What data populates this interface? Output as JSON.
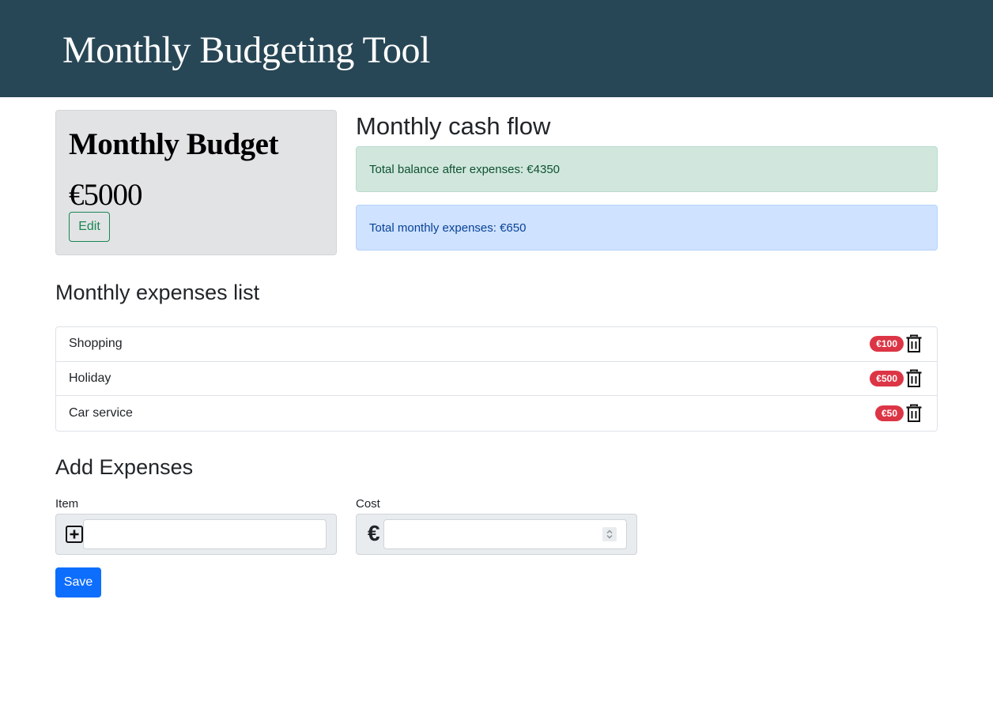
{
  "header": {
    "title": "Monthly Budgeting Tool"
  },
  "budget": {
    "title": "Monthly Budget",
    "amount": "€5000",
    "edit_label": "Edit"
  },
  "cashflow": {
    "heading": "Monthly cash flow",
    "balance_text": "Total balance after expenses: €4350",
    "expenses_text": "Total monthly expenses: €650"
  },
  "expenses": {
    "heading": "Monthly expenses list",
    "items": [
      {
        "name": "Shopping",
        "cost": "€100"
      },
      {
        "name": "Holiday",
        "cost": "€500"
      },
      {
        "name": "Car service",
        "cost": "€50"
      }
    ]
  },
  "add_form": {
    "heading": "Add Expenses",
    "item_label": "Item",
    "item_value": "",
    "cost_label": "Cost",
    "cost_symbol": "€",
    "cost_value": "",
    "save_label": "Save"
  },
  "colors": {
    "header_bg": "#284756",
    "badge": "#dc3545",
    "success_alert": "#d1e7dd",
    "primary_alert": "#cfe2ff",
    "save_button": "#0d6efd",
    "edit_button": "#198754"
  },
  "icons": {
    "trash": "trash-icon",
    "add": "plus-square-icon"
  }
}
